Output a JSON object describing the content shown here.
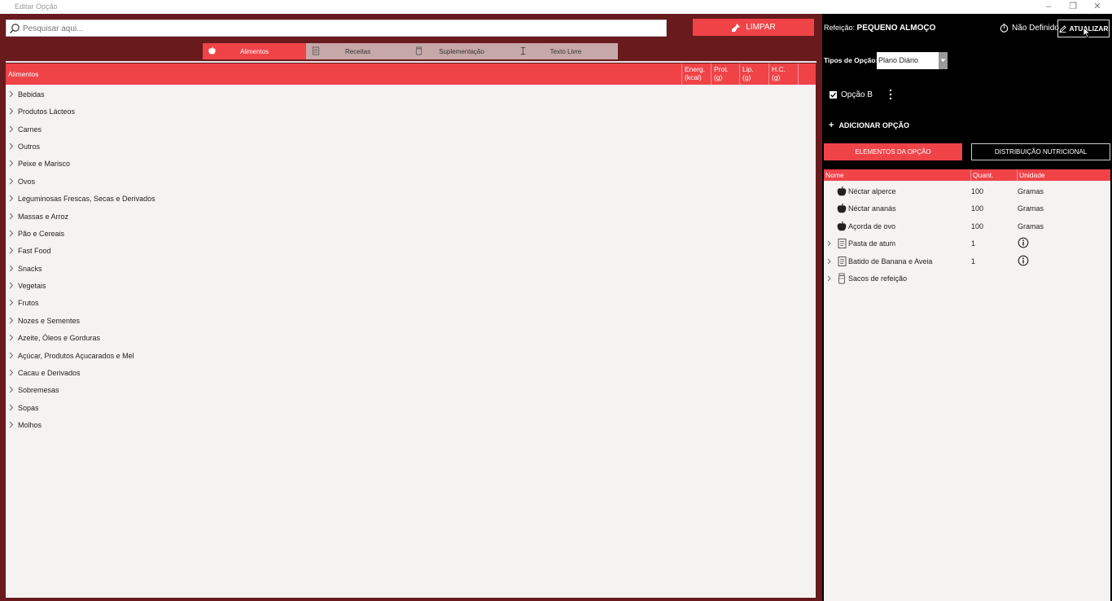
{
  "window": {
    "title": "Editar Opção"
  },
  "search": {
    "placeholder": "Pesquisar aqui..."
  },
  "limpar_label": "LIMPAR",
  "tabs": [
    {
      "label": "Alimentos",
      "icon": "apple-icon",
      "active": true
    },
    {
      "label": "Receitas",
      "icon": "recipe-icon",
      "active": false
    },
    {
      "label": "Suplementação",
      "icon": "jar-icon",
      "active": false
    },
    {
      "label": "Texto Livre",
      "icon": "text-cursor-icon",
      "active": false
    }
  ],
  "foods_table": {
    "headers": {
      "name": "Alimentos",
      "energ": "Energ.",
      "energ_unit": "(kcal)",
      "prot": "Prot.",
      "prot_unit": "(g)",
      "lip": "Lip.",
      "lip_unit": "(g)",
      "hc": "H.C.",
      "hc_unit": "(g)"
    },
    "categories": [
      "Bebidas",
      "Produtos Lácteos",
      "Carnes",
      "Outros",
      "Peixe e Marisco",
      "Ovos",
      "Leguminosas Frescas, Secas e Derivados",
      "Massas e Arroz",
      "Pão e Cereais",
      "Fast Food",
      "Snacks",
      "Vegetais",
      "Frutos",
      "Nozes e Sementes",
      "Azeite, Óleos e Gorduras",
      "Açúcar, Produtos Açucarados e Mel",
      "Cacau e Derivados",
      "Sobremesas",
      "Sopas",
      "Molhos"
    ]
  },
  "meal": {
    "label": "Refeição:",
    "name": "PEQUENO ALMOÇO",
    "time": "Não Definido",
    "update_label": "ATUALIZAR"
  },
  "option_type": {
    "label": "Tipos de Opção:",
    "value": "Plano Diário"
  },
  "option": {
    "label": "Opção B",
    "checked": true
  },
  "add_option_label": "ADICIONAR OPÇÃO",
  "subtabs": {
    "elements": "ELEMENTOS DA OPÇÃO",
    "distribution": "DISTRIBUIÇÃO NUTRICIONAL"
  },
  "elements_table": {
    "headers": {
      "name": "Nome",
      "quant": "Quant.",
      "unit": "Unidade"
    },
    "rows": [
      {
        "name": "Néctar alperce",
        "icon": "apple-icon",
        "quant": "100",
        "unit": "Gramas",
        "expandable": false
      },
      {
        "name": "Néctar ananás",
        "icon": "apple-icon",
        "quant": "100",
        "unit": "Gramas",
        "expandable": false
      },
      {
        "name": "Açorda de ovo",
        "icon": "apple-icon",
        "quant": "100",
        "unit": "Gramas",
        "expandable": false
      },
      {
        "name": "Pasta de atum",
        "icon": "recipe-icon",
        "quant": "1",
        "unit": "info-icon",
        "expandable": true
      },
      {
        "name": "Batido de Banana e Aveia",
        "icon": "recipe-icon",
        "quant": "1",
        "unit": "info-icon",
        "expandable": true
      },
      {
        "name": "Sacos de refeição",
        "icon": "jar-icon",
        "quant": "",
        "unit": "",
        "expandable": true
      }
    ]
  },
  "colors": {
    "accent": "#ef4348",
    "panel_dark": "#681a1d",
    "right_bg": "#000000",
    "table_bg": "#f4f3f1"
  }
}
